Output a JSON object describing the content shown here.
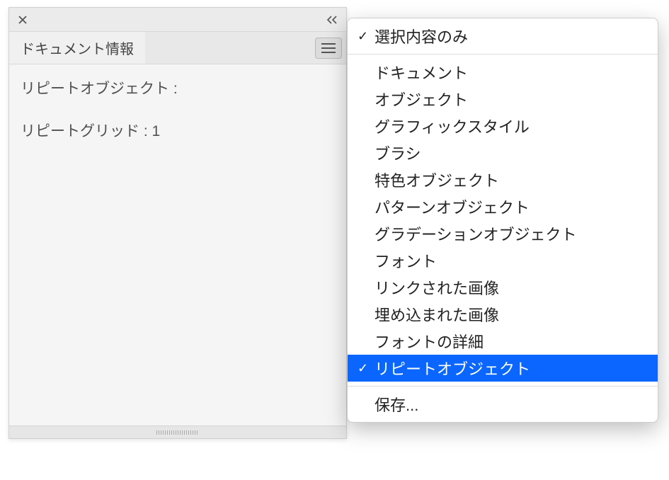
{
  "panel": {
    "tab_label": "ドキュメント情報",
    "content": {
      "line1": "リピートオブジェクト :",
      "line2": "リピートグリッド : 1"
    }
  },
  "menu": {
    "items": [
      {
        "label": "選択内容のみ",
        "checked": true,
        "highlighted": false
      },
      {
        "separator": true
      },
      {
        "label": "ドキュメント",
        "checked": false,
        "highlighted": false
      },
      {
        "label": "オブジェクト",
        "checked": false,
        "highlighted": false
      },
      {
        "label": "グラフィックスタイル",
        "checked": false,
        "highlighted": false
      },
      {
        "label": "ブラシ",
        "checked": false,
        "highlighted": false
      },
      {
        "label": "特色オブジェクト",
        "checked": false,
        "highlighted": false
      },
      {
        "label": "パターンオブジェクト",
        "checked": false,
        "highlighted": false
      },
      {
        "label": "グラデーションオブジェクト",
        "checked": false,
        "highlighted": false
      },
      {
        "label": "フォント",
        "checked": false,
        "highlighted": false
      },
      {
        "label": "リンクされた画像",
        "checked": false,
        "highlighted": false
      },
      {
        "label": "埋め込まれた画像",
        "checked": false,
        "highlighted": false
      },
      {
        "label": "フォントの詳細",
        "checked": false,
        "highlighted": false
      },
      {
        "label": "リピートオブジェクト",
        "checked": true,
        "highlighted": true
      },
      {
        "separator": true
      },
      {
        "label": "保存...",
        "checked": false,
        "highlighted": false
      }
    ]
  }
}
